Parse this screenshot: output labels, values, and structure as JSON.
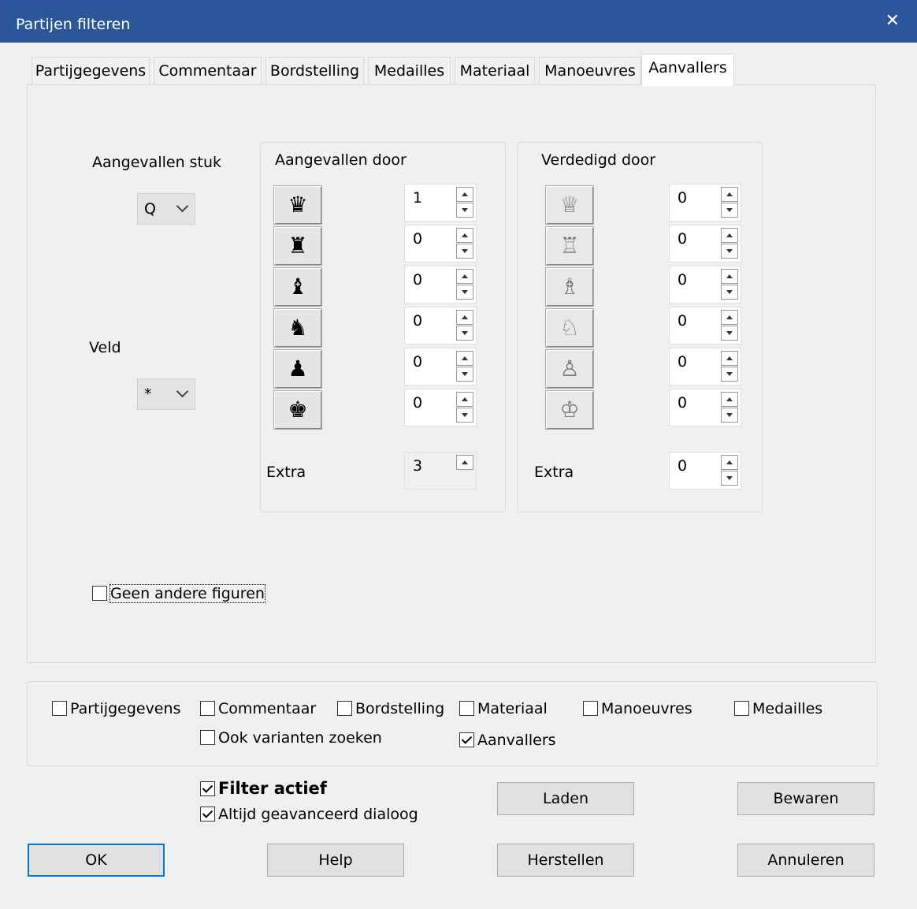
{
  "window": {
    "title": "Partijen filteren",
    "close_glyph": "✕"
  },
  "tabs": [
    {
      "label": "Partijgegevens"
    },
    {
      "label": "Commentaar"
    },
    {
      "label": "Bordstelling"
    },
    {
      "label": "Medailles"
    },
    {
      "label": "Materiaal"
    },
    {
      "label": "Manoeuvres"
    },
    {
      "label": "Aanvallers",
      "active": true
    }
  ],
  "aanvallers": {
    "attacked_piece_label": "Aangevallen stuk",
    "attacked_piece_value": "Q",
    "square_label": "Veld",
    "square_value": "*",
    "attacked_by": {
      "title": "Aangevallen door",
      "rows": [
        {
          "piece": "queen",
          "glyph": "♛",
          "value": "1"
        },
        {
          "piece": "rook",
          "glyph": "♜",
          "value": "0"
        },
        {
          "piece": "bishop",
          "glyph": "♝",
          "value": "0"
        },
        {
          "piece": "knight",
          "glyph": "♞",
          "value": "0"
        },
        {
          "piece": "pawn",
          "glyph": "♟",
          "value": "0"
        },
        {
          "piece": "king",
          "glyph": "♚",
          "value": "0"
        }
      ],
      "extra_label": "Extra",
      "extra_value": "3"
    },
    "defended_by": {
      "title": "Verdedigd door",
      "rows": [
        {
          "piece": "queen",
          "glyph": "♕",
          "value": "0"
        },
        {
          "piece": "rook",
          "glyph": "♖",
          "value": "0"
        },
        {
          "piece": "bishop",
          "glyph": "♗",
          "value": "0"
        },
        {
          "piece": "knight",
          "glyph": "♘",
          "value": "0"
        },
        {
          "piece": "pawn",
          "glyph": "♙",
          "value": "0"
        },
        {
          "piece": "king",
          "glyph": "♔",
          "value": "0"
        }
      ],
      "extra_label": "Extra",
      "extra_value": "0"
    },
    "no_other_pieces": {
      "label": "Geen andere figuren",
      "checked": false
    }
  },
  "filter_checks": {
    "partijgegevens": {
      "label": "Partijgegevens",
      "checked": false
    },
    "commentaar": {
      "label": "Commentaar",
      "checked": false
    },
    "bordstelling": {
      "label": "Bordstelling",
      "checked": false
    },
    "materiaal": {
      "label": "Materiaal",
      "checked": false
    },
    "manoeuvres": {
      "label": "Manoeuvres",
      "checked": false
    },
    "medailles": {
      "label": "Medailles",
      "checked": false
    },
    "varianten": {
      "label": "Ook varianten zoeken",
      "checked": false
    },
    "aanvallers": {
      "label": "Aanvallers",
      "checked": true
    }
  },
  "options": {
    "filter_actief": {
      "label": "Filter actief",
      "checked": true
    },
    "altijd_geavanceerd": {
      "label": "Altijd geavanceerd dialoog",
      "checked": true
    }
  },
  "buttons": {
    "laden": "Laden",
    "bewaren": "Bewaren",
    "ok": "OK",
    "help": "Help",
    "herstellen": "Herstellen",
    "annuleren": "Annuleren"
  },
  "colors": {
    "titlebar": "#2b579a",
    "default_button_border": "#0078d7"
  }
}
